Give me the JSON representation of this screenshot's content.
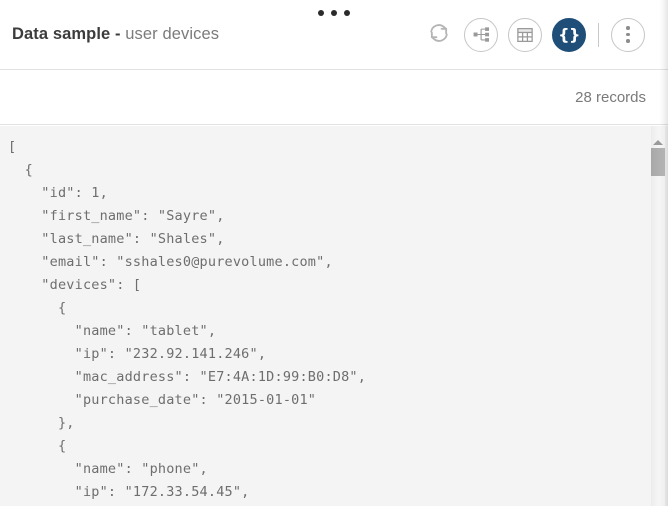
{
  "window": {
    "drag_handle_icon": "drag-dots-icon"
  },
  "header": {
    "title_bold": "Data sample",
    "title_dash": " - ",
    "title_sub": "user devices",
    "toolbar": [
      {
        "name": "refresh-button",
        "icon": "refresh-icon",
        "label": "Refresh",
        "active": false
      },
      {
        "name": "tree-view-button",
        "icon": "tree-view-icon",
        "label": "Tree view",
        "active": false
      },
      {
        "name": "table-view-button",
        "icon": "table-view-icon",
        "label": "Table view",
        "active": false
      },
      {
        "name": "json-view-button",
        "icon": "json-braces-icon",
        "label": "{}",
        "active": true
      },
      {
        "name": "more-options-button",
        "icon": "more-vertical-icon",
        "label": "More options",
        "active": false
      }
    ]
  },
  "records": {
    "count_label": "28 records"
  },
  "viewer": {
    "mode": "json",
    "scrollbar_icon": "scroll-up-arrow-icon",
    "content": "[\n  {\n    \"id\": 1,\n    \"first_name\": \"Sayre\",\n    \"last_name\": \"Shales\",\n    \"email\": \"sshales0@purevolume.com\",\n    \"devices\": [\n      {\n        \"name\": \"tablet\",\n        \"ip\": \"232.92.141.246\",\n        \"mac_address\": \"E7:4A:1D:99:B0:D8\",\n        \"purchase_date\": \"2015-01-01\"\n      },\n      {\n        \"name\": \"phone\",\n        \"ip\": \"172.33.54.45\","
  },
  "colors": {
    "accent": "#1f4e79",
    "title_strong": "#3c3c3c",
    "title_muted": "#7b7b7b",
    "code_text": "#6e6e6e",
    "code_background": "#f4f4f4",
    "icon_gray": "#8d8d8d"
  }
}
